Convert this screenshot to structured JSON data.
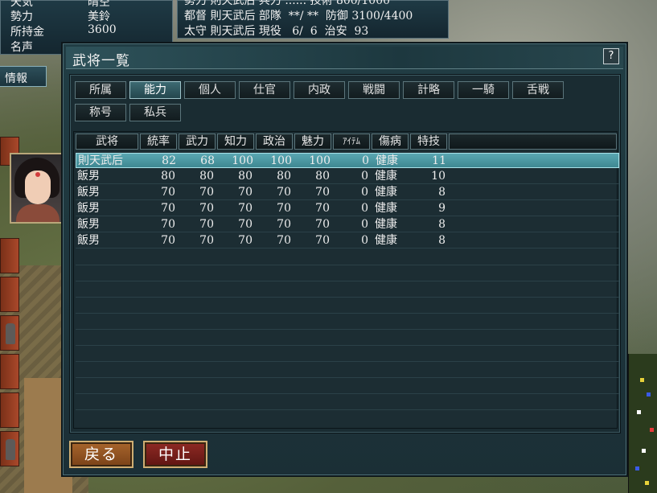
{
  "status_left": {
    "rows": [
      {
        "label": "天気",
        "value": "晴空"
      },
      {
        "label": "勢力",
        "value": "美鈴"
      },
      {
        "label": "所持金",
        "value": "3600"
      },
      {
        "label": "名声",
        "value": ""
      }
    ]
  },
  "status_right": {
    "rows": [
      "勢力 則天武后 兵力 ...... 技術 800/1000",
      "都督 則天武后 部隊  **/ **  防御 3100/4400",
      "太守 則天武后 現役   6/  6  治安  93"
    ]
  },
  "side": {
    "info_label": "情報"
  },
  "dialog": {
    "title": "武将一覧",
    "help_label": "?",
    "tabs": [
      "所属",
      "能力",
      "個人",
      "仕官",
      "内政",
      "戦闘",
      "計略",
      "一騎",
      "舌戦",
      "称号",
      "私兵"
    ],
    "active_tab": "能力",
    "columns": [
      "武将",
      "統率",
      "武力",
      "知力",
      "政治",
      "魅力",
      "ｱｲﾃﾑ",
      "傷病",
      "特技",
      ""
    ],
    "rows": [
      {
        "name": "則天武后",
        "tousotsu": "82",
        "buryoku": "68",
        "chiryoku": "100",
        "seiji": "100",
        "miryoku": "100",
        "item": "0",
        "shoubyou": "健康",
        "tokugi": "11"
      },
      {
        "name": "飯男",
        "tousotsu": "80",
        "buryoku": "80",
        "chiryoku": "80",
        "seiji": "80",
        "miryoku": "80",
        "item": "0",
        "shoubyou": "健康",
        "tokugi": "10"
      },
      {
        "name": "飯男",
        "tousotsu": "70",
        "buryoku": "70",
        "chiryoku": "70",
        "seiji": "70",
        "miryoku": "70",
        "item": "0",
        "shoubyou": "健康",
        "tokugi": "8"
      },
      {
        "name": "飯男",
        "tousotsu": "70",
        "buryoku": "70",
        "chiryoku": "70",
        "seiji": "70",
        "miryoku": "70",
        "item": "0",
        "shoubyou": "健康",
        "tokugi": "9"
      },
      {
        "name": "飯男",
        "tousotsu": "70",
        "buryoku": "70",
        "chiryoku": "70",
        "seiji": "70",
        "miryoku": "70",
        "item": "0",
        "shoubyou": "健康",
        "tokugi": "8"
      },
      {
        "name": "飯男",
        "tousotsu": "70",
        "buryoku": "70",
        "chiryoku": "70",
        "seiji": "70",
        "miryoku": "70",
        "item": "0",
        "shoubyou": "健康",
        "tokugi": "8"
      }
    ],
    "selected_row": 0,
    "back_label": "戻る",
    "cancel_label": "中止"
  },
  "colors": {
    "selected_row": "#4f9aa4",
    "dialog_bg": "#1b2f36",
    "back_button": "#8f5322",
    "cancel_button": "#7a1f1a"
  }
}
